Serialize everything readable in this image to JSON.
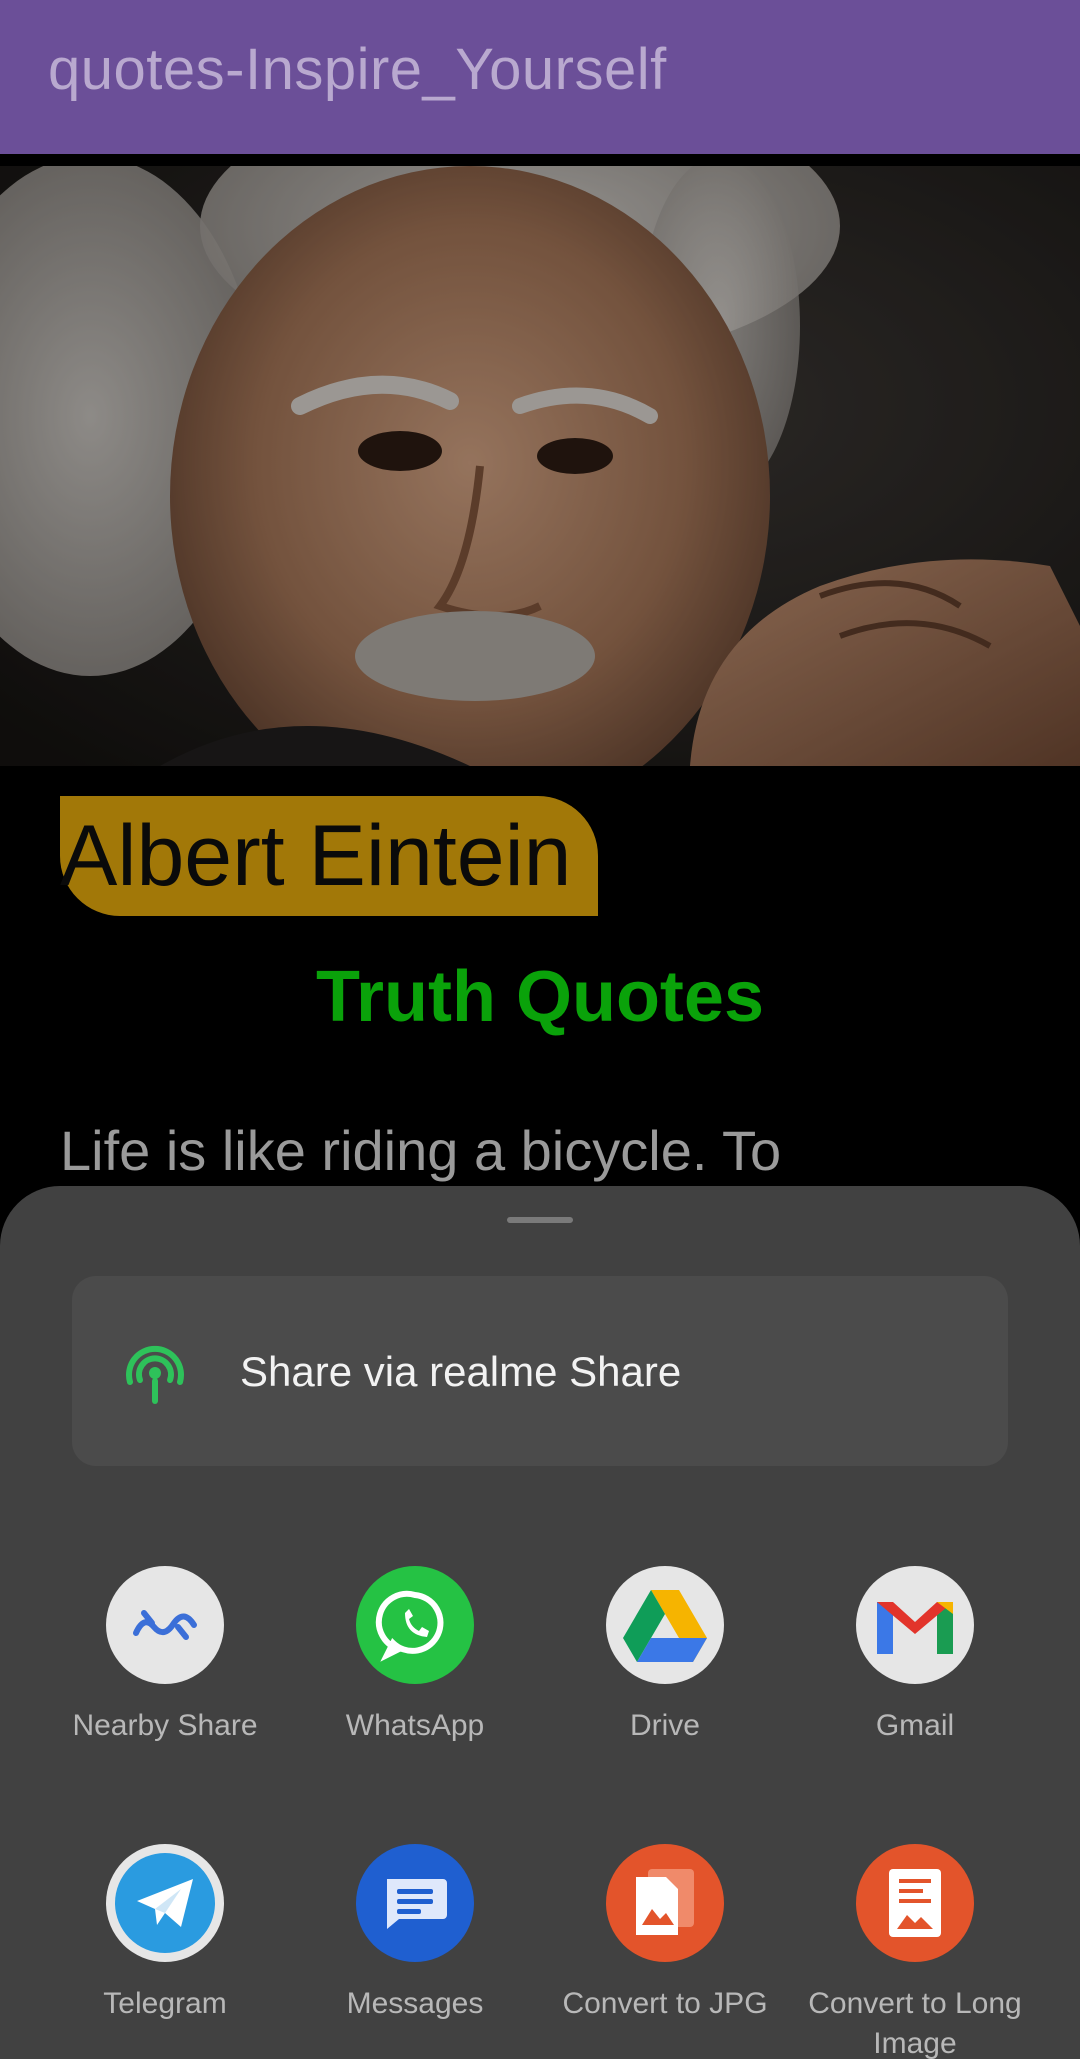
{
  "app_bar": {
    "title": "quotes-Inspire_Yourself"
  },
  "quote_card": {
    "author": "Albert Eintein",
    "category": "Truth Quotes",
    "quote_text": "Life is like riding a bicycle. To"
  },
  "share_sheet": {
    "realme_share_label": "Share via realme Share",
    "apps": [
      {
        "label": "Nearby Share",
        "icon": "nearby-share-icon"
      },
      {
        "label": "WhatsApp",
        "icon": "whatsapp-icon"
      },
      {
        "label": "Drive",
        "icon": "google-drive-icon"
      },
      {
        "label": "Gmail",
        "icon": "gmail-icon"
      },
      {
        "label": "Telegram",
        "icon": "telegram-icon"
      },
      {
        "label": "Messages",
        "icon": "messages-icon"
      },
      {
        "label": "Convert to JPG",
        "icon": "convert-jpg-icon"
      },
      {
        "label": "Convert to Long Image",
        "icon": "convert-long-image-icon"
      }
    ]
  },
  "colors": {
    "app_bar": "#6b4f98",
    "author_badge": "#a27808",
    "category": "#0aa20a",
    "sheet": "#414141"
  }
}
